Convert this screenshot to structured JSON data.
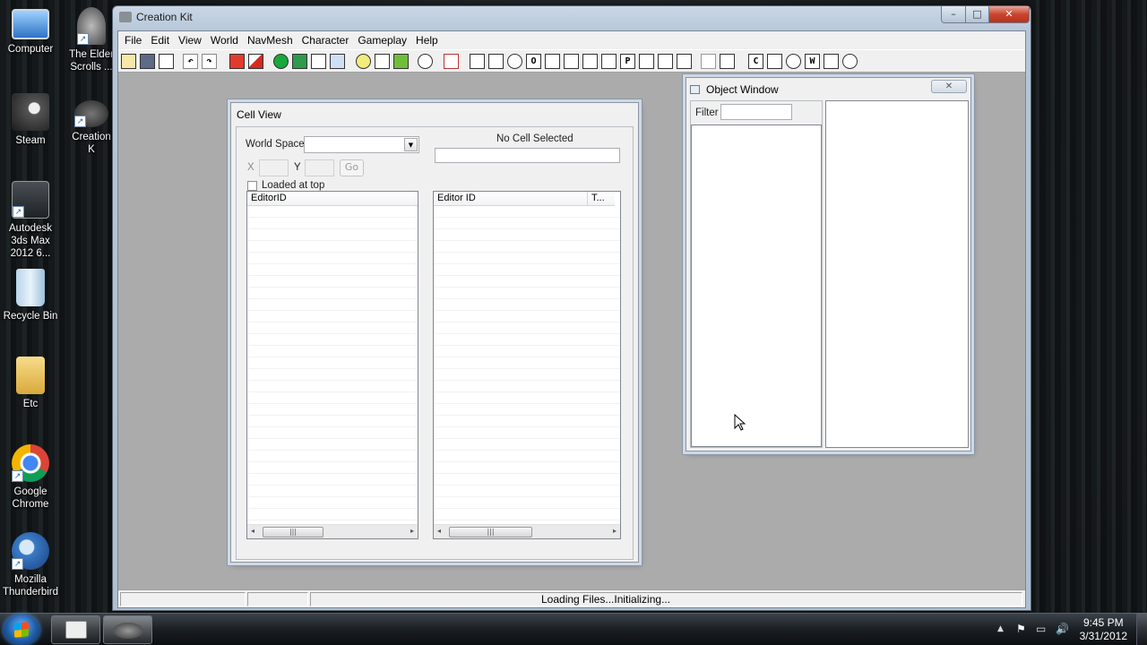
{
  "desktop": {
    "icons_left": [
      {
        "label": "Computer"
      },
      {
        "label": "Steam"
      },
      {
        "label": "Autodesk 3ds Max 2012 6..."
      },
      {
        "label": "Recycle Bin"
      },
      {
        "label": "Etc"
      },
      {
        "label": "Google Chrome"
      },
      {
        "label": "Mozilla Thunderbird"
      }
    ],
    "icons_second": [
      {
        "label": "The Elder Scrolls ..."
      },
      {
        "label": "Creation K"
      }
    ]
  },
  "window": {
    "title": "Creation Kit",
    "menu": [
      "File",
      "Edit",
      "View",
      "World",
      "NavMesh",
      "Character",
      "Gameplay",
      "Help"
    ],
    "toolbar_letters": [
      "O",
      "P",
      "C",
      "W"
    ],
    "status": "Loading Files...Initializing..."
  },
  "cell_view": {
    "title": "Cell View",
    "world_space_label": "World Space",
    "x_label": "X",
    "y_label": "Y",
    "go_label": "Go",
    "loaded_at_top_label": "Loaded at top",
    "no_cell_label": "No Cell Selected",
    "left_col": "EditorID",
    "right_col": "Editor ID",
    "right_col2": "T..."
  },
  "object_window": {
    "title": "Object Window",
    "filter_label": "Filter"
  },
  "taskbar": {
    "time": "9:45 PM",
    "date": "3/31/2012"
  },
  "colors": {
    "titlebar": "#c9d7e6",
    "close": "#c8452f",
    "workspace": "#ababab"
  }
}
